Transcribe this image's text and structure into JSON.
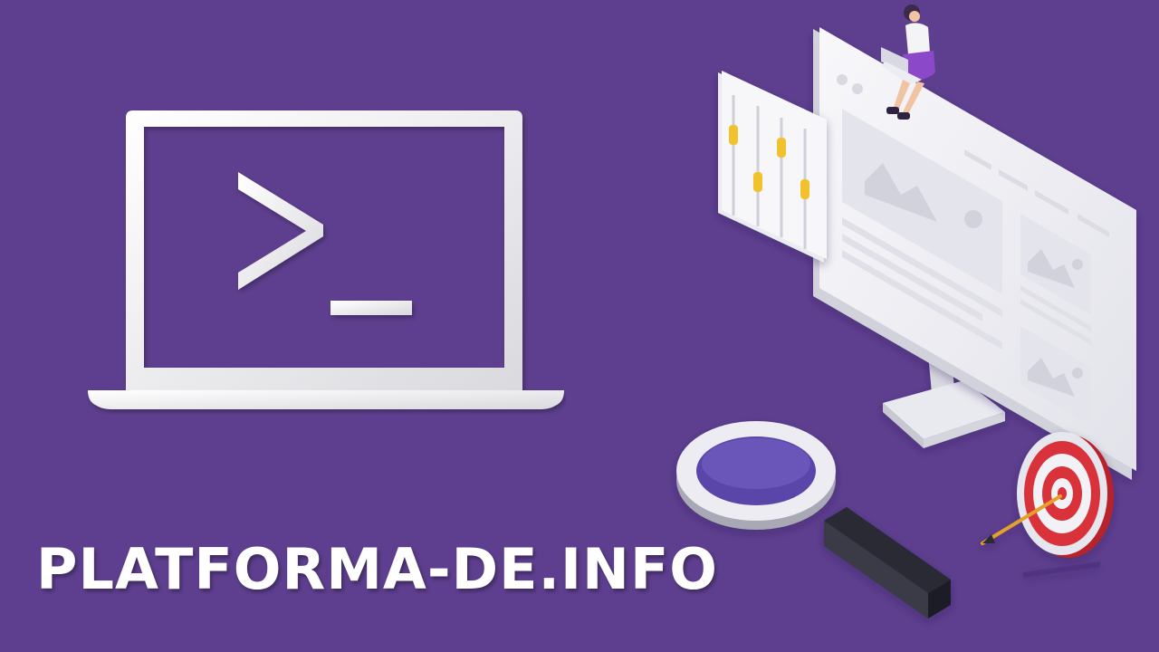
{
  "brand": {
    "site_title": "PLATFORMA-DE.INFO"
  },
  "icons": {
    "laptop": "laptop-terminal-icon",
    "prompt": "terminal-prompt-icon",
    "monitor": "web-browser-monitor-icon",
    "settings_panel": "slider-panel-icon",
    "person": "woman-with-laptop-icon",
    "magnifier": "magnifying-glass-icon",
    "target": "target-with-arrow-icon"
  },
  "colors": {
    "background": "#5e3f8f",
    "foreground": "#ffffff",
    "slider_accent": "#f2c12e",
    "target_red": "#d9303a",
    "lens": "#5a45a8"
  }
}
